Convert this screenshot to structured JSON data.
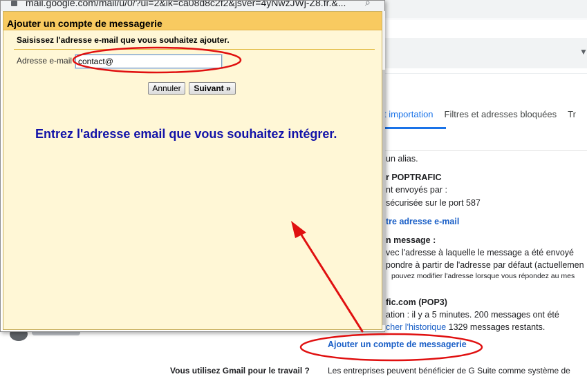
{
  "popup": {
    "url": "mail.google.com/mail/u/0/?ui=2&ik=ca08d8c2f2&jsver=4yNwzJWj-Z8.fr.&...",
    "title": "Ajouter un compte de messagerie",
    "instruction": "Saisissez l'adresse e-mail que vous souhaitez ajouter.",
    "email_label": "Adresse e-mail :",
    "email_value": "contact@",
    "cancel_label": "Annuler",
    "next_label": "Suivant »",
    "caption": "Entrez l'adresse email que vous souhaitez intégrer."
  },
  "settings": {
    "tabs": [
      "t importation",
      "Filtres et adresses bloquées",
      "Tr"
    ],
    "alias_text": "un alias.",
    "account_header": "r POPTRAFIC",
    "sent_via": "nt envoyés par :",
    "smtp_text": "sécurisée sur le port 587",
    "add_address_link": "tre adresse e-mail",
    "reply_header": "n message :",
    "reply_opt1": "vec l'adresse à laquelle le message a été envoyé",
    "reply_opt2": "pondre à partir de l'adresse par défaut (actuellemen",
    "reply_note": "pouvez modifier l'adresse lorsque vous répondez au mes",
    "pop_account": "fic.com (POP3)",
    "pop_status": "ation : il y a 5 minutes. 200 messages ont été",
    "history_link": "cher l'historique",
    "remaining": "1329 messages restants.",
    "add_account_link": "Ajouter un compte de messagerie",
    "work_label": "Vous utilisez Gmail pour le travail ?",
    "work_text": "Les entreprises peuvent bénéficier de G Suite comme système de"
  },
  "colors": {
    "annotation": "#e01010",
    "title_bar": "#f8ca60",
    "popup_background": "#fff7d6",
    "caption": "#1212a8",
    "link": "#1a5fc7"
  }
}
